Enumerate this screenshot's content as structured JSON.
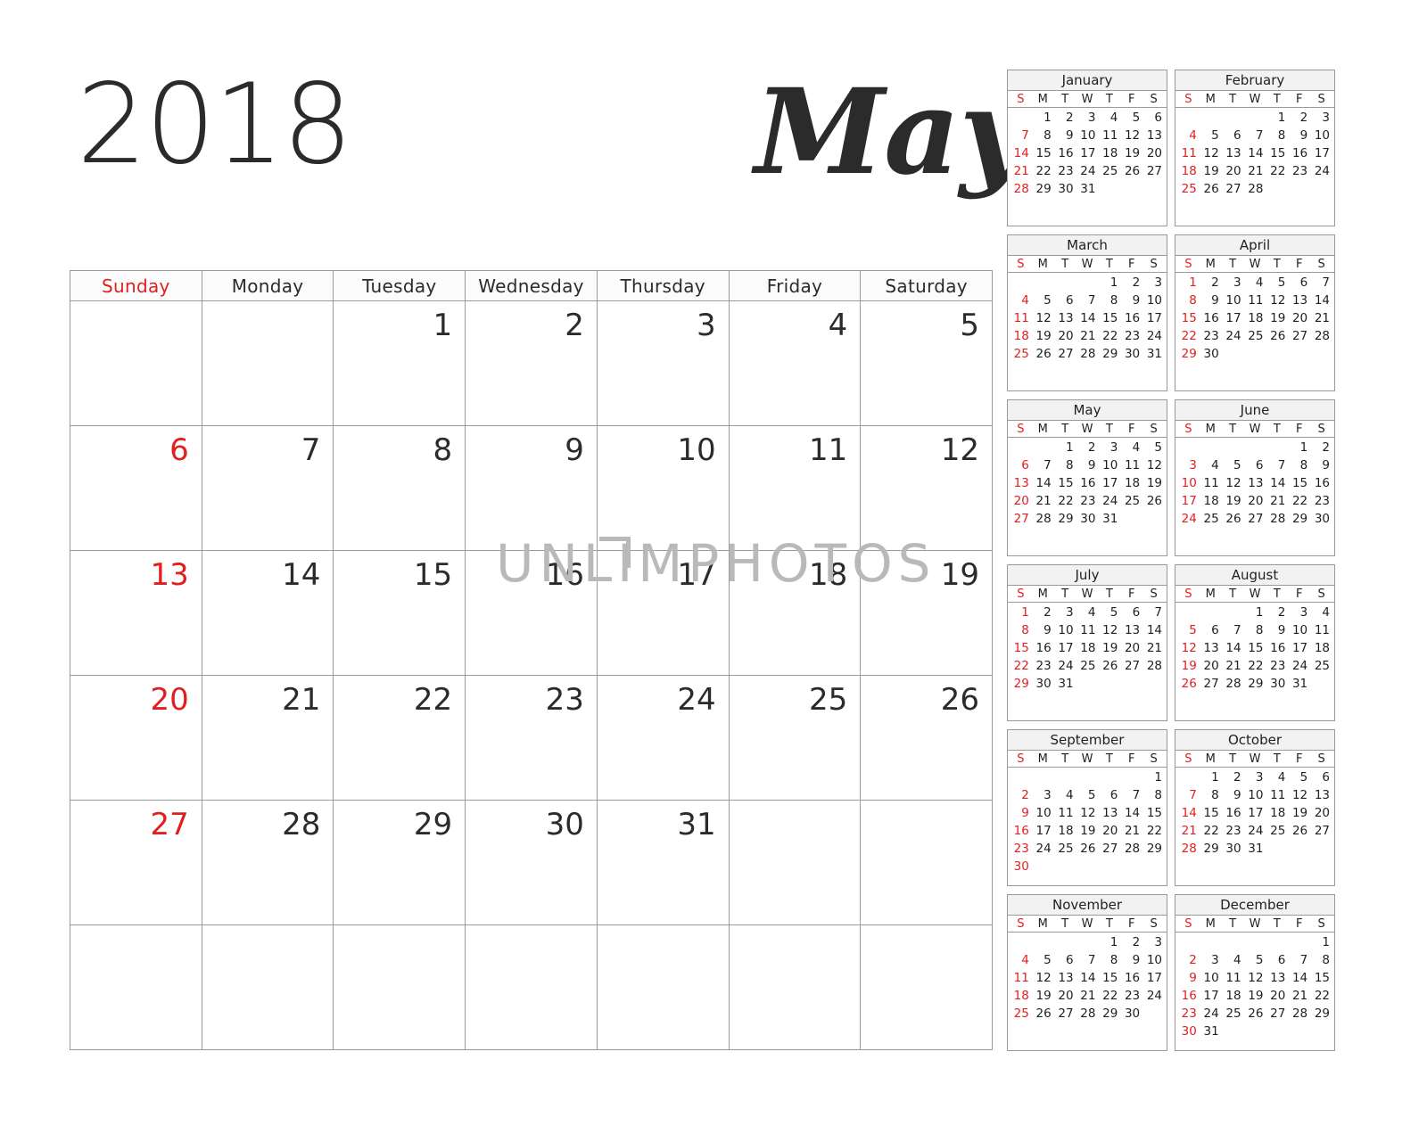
{
  "header": {
    "year": "2018",
    "month": "May"
  },
  "watermark": {
    "text": "UNLIMPHOTOS",
    "mark": "corner-bracket"
  },
  "colors": {
    "sunday_red": "#e02020",
    "text_dark": "#2b2b2b",
    "grid_line": "#9a9a9a",
    "header_bg": "#fbfbfb",
    "mini_title_bg": "#f2f2f2",
    "watermark_gray": "#b9b9b9"
  },
  "main_calendar": {
    "day_headers": [
      "Sunday",
      "Monday",
      "Tuesday",
      "Wednesday",
      "Thursday",
      "Friday",
      "Saturday"
    ],
    "weeks": [
      [
        "",
        "",
        "1",
        "2",
        "3",
        "4",
        "5"
      ],
      [
        "6",
        "7",
        "8",
        "9",
        "10",
        "11",
        "12"
      ],
      [
        "13",
        "14",
        "15",
        "16",
        "17",
        "18",
        "19"
      ],
      [
        "20",
        "21",
        "22",
        "23",
        "24",
        "25",
        "26"
      ],
      [
        "27",
        "28",
        "29",
        "30",
        "31",
        "",
        ""
      ],
      [
        "",
        "",
        "",
        "",
        "",
        "",
        ""
      ]
    ]
  },
  "mini_calendars": {
    "dow_letters": [
      "S",
      "M",
      "T",
      "W",
      "T",
      "F",
      "S"
    ],
    "months": [
      {
        "name": "January",
        "weeks": [
          [
            "",
            "1",
            "2",
            "3",
            "4",
            "5",
            "6"
          ],
          [
            "7",
            "8",
            "9",
            "10",
            "11",
            "12",
            "13"
          ],
          [
            "14",
            "15",
            "16",
            "17",
            "18",
            "19",
            "20"
          ],
          [
            "21",
            "22",
            "23",
            "24",
            "25",
            "26",
            "27"
          ],
          [
            "28",
            "29",
            "30",
            "31",
            "",
            "",
            ""
          ],
          [
            "",
            "",
            "",
            "",
            "",
            "",
            ""
          ]
        ]
      },
      {
        "name": "February",
        "weeks": [
          [
            "",
            "",
            "",
            "",
            "1",
            "2",
            "3"
          ],
          [
            "4",
            "5",
            "6",
            "7",
            "8",
            "9",
            "10"
          ],
          [
            "11",
            "12",
            "13",
            "14",
            "15",
            "16",
            "17"
          ],
          [
            "18",
            "19",
            "20",
            "21",
            "22",
            "23",
            "24"
          ],
          [
            "25",
            "26",
            "27",
            "28",
            "",
            "",
            ""
          ],
          [
            "",
            "",
            "",
            "",
            "",
            "",
            ""
          ]
        ]
      },
      {
        "name": "March",
        "weeks": [
          [
            "",
            "",
            "",
            "",
            "1",
            "2",
            "3"
          ],
          [
            "4",
            "5",
            "6",
            "7",
            "8",
            "9",
            "10"
          ],
          [
            "11",
            "12",
            "13",
            "14",
            "15",
            "16",
            "17"
          ],
          [
            "18",
            "19",
            "20",
            "21",
            "22",
            "23",
            "24"
          ],
          [
            "25",
            "26",
            "27",
            "28",
            "29",
            "30",
            "31"
          ],
          [
            "",
            "",
            "",
            "",
            "",
            "",
            ""
          ]
        ]
      },
      {
        "name": "April",
        "weeks": [
          [
            "1",
            "2",
            "3",
            "4",
            "5",
            "6",
            "7"
          ],
          [
            "8",
            "9",
            "10",
            "11",
            "12",
            "13",
            "14"
          ],
          [
            "15",
            "16",
            "17",
            "18",
            "19",
            "20",
            "21"
          ],
          [
            "22",
            "23",
            "24",
            "25",
            "26",
            "27",
            "28"
          ],
          [
            "29",
            "30",
            "",
            "",
            "",
            "",
            ""
          ],
          [
            "",
            "",
            "",
            "",
            "",
            "",
            ""
          ]
        ]
      },
      {
        "name": "May",
        "weeks": [
          [
            "",
            "",
            "1",
            "2",
            "3",
            "4",
            "5"
          ],
          [
            "6",
            "7",
            "8",
            "9",
            "10",
            "11",
            "12"
          ],
          [
            "13",
            "14",
            "15",
            "16",
            "17",
            "18",
            "19"
          ],
          [
            "20",
            "21",
            "22",
            "23",
            "24",
            "25",
            "26"
          ],
          [
            "27",
            "28",
            "29",
            "30",
            "31",
            "",
            ""
          ],
          [
            "",
            "",
            "",
            "",
            "",
            "",
            ""
          ]
        ]
      },
      {
        "name": "June",
        "weeks": [
          [
            "",
            "",
            "",
            "",
            "",
            "1",
            "2"
          ],
          [
            "3",
            "4",
            "5",
            "6",
            "7",
            "8",
            "9"
          ],
          [
            "10",
            "11",
            "12",
            "13",
            "14",
            "15",
            "16"
          ],
          [
            "17",
            "18",
            "19",
            "20",
            "21",
            "22",
            "23"
          ],
          [
            "24",
            "25",
            "26",
            "27",
            "28",
            "29",
            "30"
          ],
          [
            "",
            "",
            "",
            "",
            "",
            "",
            ""
          ]
        ]
      },
      {
        "name": "July",
        "weeks": [
          [
            "1",
            "2",
            "3",
            "4",
            "5",
            "6",
            "7"
          ],
          [
            "8",
            "9",
            "10",
            "11",
            "12",
            "13",
            "14"
          ],
          [
            "15",
            "16",
            "17",
            "18",
            "19",
            "20",
            "21"
          ],
          [
            "22",
            "23",
            "24",
            "25",
            "26",
            "27",
            "28"
          ],
          [
            "29",
            "30",
            "31",
            "",
            "",
            "",
            ""
          ],
          [
            "",
            "",
            "",
            "",
            "",
            "",
            ""
          ]
        ]
      },
      {
        "name": "August",
        "weeks": [
          [
            "",
            "",
            "",
            "1",
            "2",
            "3",
            "4"
          ],
          [
            "5",
            "6",
            "7",
            "8",
            "9",
            "10",
            "11"
          ],
          [
            "12",
            "13",
            "14",
            "15",
            "16",
            "17",
            "18"
          ],
          [
            "19",
            "20",
            "21",
            "22",
            "23",
            "24",
            "25"
          ],
          [
            "26",
            "27",
            "28",
            "29",
            "30",
            "31",
            ""
          ],
          [
            "",
            "",
            "",
            "",
            "",
            "",
            ""
          ]
        ]
      },
      {
        "name": "September",
        "weeks": [
          [
            "",
            "",
            "",
            "",
            "",
            "",
            "1"
          ],
          [
            "2",
            "3",
            "4",
            "5",
            "6",
            "7",
            "8"
          ],
          [
            "9",
            "10",
            "11",
            "12",
            "13",
            "14",
            "15"
          ],
          [
            "16",
            "17",
            "18",
            "19",
            "20",
            "21",
            "22"
          ],
          [
            "23",
            "24",
            "25",
            "26",
            "27",
            "28",
            "29"
          ],
          [
            "30",
            "",
            "",
            "",
            "",
            "",
            ""
          ]
        ]
      },
      {
        "name": "October",
        "weeks": [
          [
            "",
            "1",
            "2",
            "3",
            "4",
            "5",
            "6"
          ],
          [
            "7",
            "8",
            "9",
            "10",
            "11",
            "12",
            "13"
          ],
          [
            "14",
            "15",
            "16",
            "17",
            "18",
            "19",
            "20"
          ],
          [
            "21",
            "22",
            "23",
            "24",
            "25",
            "26",
            "27"
          ],
          [
            "28",
            "29",
            "30",
            "31",
            "",
            "",
            ""
          ],
          [
            "",
            "",
            "",
            "",
            "",
            "",
            ""
          ]
        ]
      },
      {
        "name": "November",
        "weeks": [
          [
            "",
            "",
            "",
            "",
            "1",
            "2",
            "3"
          ],
          [
            "4",
            "5",
            "6",
            "7",
            "8",
            "9",
            "10"
          ],
          [
            "11",
            "12",
            "13",
            "14",
            "15",
            "16",
            "17"
          ],
          [
            "18",
            "19",
            "20",
            "21",
            "22",
            "23",
            "24"
          ],
          [
            "25",
            "26",
            "27",
            "28",
            "29",
            "30",
            ""
          ],
          [
            "",
            "",
            "",
            "",
            "",
            "",
            ""
          ]
        ]
      },
      {
        "name": "December",
        "weeks": [
          [
            "",
            "",
            "",
            "",
            "",
            "",
            "1"
          ],
          [
            "2",
            "3",
            "4",
            "5",
            "6",
            "7",
            "8"
          ],
          [
            "9",
            "10",
            "11",
            "12",
            "13",
            "14",
            "15"
          ],
          [
            "16",
            "17",
            "18",
            "19",
            "20",
            "21",
            "22"
          ],
          [
            "23",
            "24",
            "25",
            "26",
            "27",
            "28",
            "29"
          ],
          [
            "30",
            "31",
            "",
            "",
            "",
            "",
            ""
          ]
        ]
      }
    ]
  }
}
